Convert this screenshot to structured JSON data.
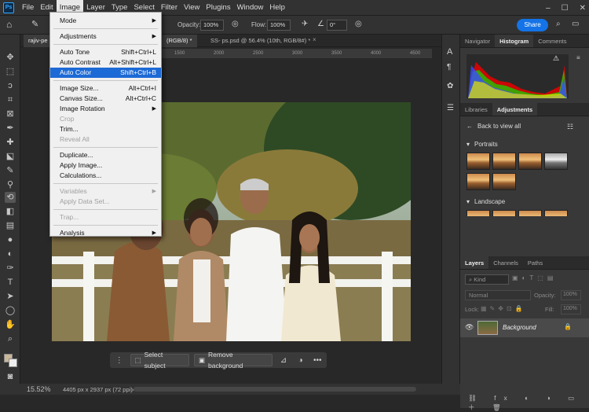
{
  "menubar": {
    "logo": "Ps",
    "items": [
      "File",
      "Edit",
      "Image",
      "Layer",
      "Type",
      "Select",
      "Filter",
      "View",
      "Plugins",
      "Window",
      "Help"
    ],
    "active": "Image"
  },
  "options": {
    "opacity_label": "Opacity:",
    "opacity_value": "100%",
    "flow_label": "Flow:",
    "flow_value": "100%",
    "angle_value": "0°",
    "share_label": "Share"
  },
  "tabs": [
    {
      "label": "rajiv-pe",
      "active": true
    },
    {
      "label": "(RGB/8) *",
      "active": true
    },
    {
      "label": "SS- ps.psd @ 56.4% (10th, RGB/8#) *",
      "active": false
    }
  ],
  "ruler": {
    "ticks": [
      "1500",
      "2000",
      "2500",
      "3000",
      "3500",
      "4000",
      "4500"
    ]
  },
  "image_menu": {
    "items": [
      {
        "label": "Mode",
        "shortcut": "",
        "submenu": true,
        "disabled": false
      },
      {
        "sep": true
      },
      {
        "label": "Adjustments",
        "shortcut": "",
        "submenu": true,
        "disabled": false
      },
      {
        "sep": true
      },
      {
        "label": "Auto Tone",
        "shortcut": "Shift+Ctrl+L",
        "disabled": false
      },
      {
        "label": "Auto Contrast",
        "shortcut": "Alt+Shift+Ctrl+L",
        "disabled": false
      },
      {
        "label": "Auto Color",
        "shortcut": "Shift+Ctrl+B",
        "disabled": false,
        "highlighted": true
      },
      {
        "sep": true
      },
      {
        "label": "Image Size...",
        "shortcut": "Alt+Ctrl+I",
        "disabled": false
      },
      {
        "label": "Canvas Size...",
        "shortcut": "Alt+Ctrl+C",
        "disabled": false
      },
      {
        "label": "Image Rotation",
        "shortcut": "",
        "submenu": true,
        "disabled": false
      },
      {
        "label": "Crop",
        "shortcut": "",
        "disabled": true
      },
      {
        "label": "Trim...",
        "shortcut": "",
        "disabled": false
      },
      {
        "label": "Reveal All",
        "shortcut": "",
        "disabled": true
      },
      {
        "sep": true
      },
      {
        "label": "Duplicate...",
        "shortcut": "",
        "disabled": false
      },
      {
        "label": "Apply Image...",
        "shortcut": "",
        "disabled": false
      },
      {
        "label": "Calculations...",
        "shortcut": "",
        "disabled": false
      },
      {
        "sep": true
      },
      {
        "label": "Variables",
        "shortcut": "",
        "submenu": true,
        "disabled": true
      },
      {
        "label": "Apply Data Set...",
        "shortcut": "",
        "disabled": true
      },
      {
        "sep": true
      },
      {
        "label": "Trap...",
        "shortcut": "",
        "disabled": true
      },
      {
        "sep": true
      },
      {
        "label": "Analysis",
        "shortcut": "",
        "submenu": true,
        "disabled": false
      }
    ]
  },
  "context_bar": {
    "select_subject": "Select subject",
    "remove_background": "Remove background"
  },
  "status": {
    "zoom": "15.52%",
    "doc_info": "4405 px x 2937 px (72 ppi)"
  },
  "panels": {
    "top_tabs": [
      "Navigator",
      "Histogram",
      "Comments"
    ],
    "top_active": "Histogram",
    "mid_tabs": [
      "Libraries",
      "Adjustments"
    ],
    "mid_active": "Adjustments",
    "back_label": "Back to view all",
    "portraits_label": "Portraits",
    "landscape_label": "Landscape",
    "layer_tabs": [
      "Layers",
      "Channels",
      "Paths"
    ],
    "layer_active": "Layers",
    "kind_label": "Kind",
    "blend_mode": "Normal",
    "opacity_label": "Opacity:",
    "opacity_value": "100%",
    "lock_label": "Lock:",
    "fill_label": "Fill:",
    "fill_value": "100%",
    "layer_name": "Background"
  },
  "colors": {
    "accent": "#1473e6",
    "menu_highlight": "#1c6ad6",
    "chrome": "#323232"
  }
}
